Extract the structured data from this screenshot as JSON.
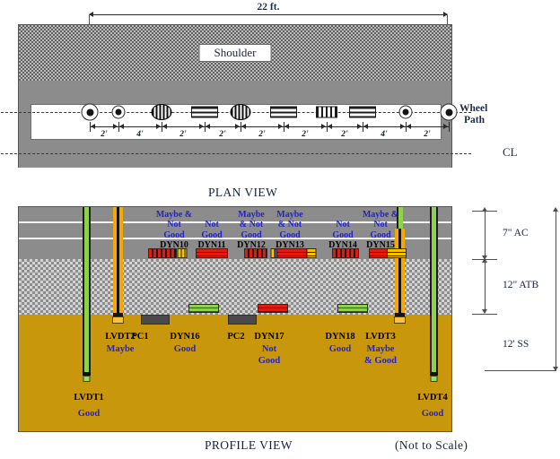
{
  "figure": {
    "plan_view_title": "PLAN VIEW",
    "profile_view_title": "PROFILE VIEW",
    "not_to_scale": "(Not to Scale)"
  },
  "plan": {
    "overall_dimension": "22 ft.",
    "shoulder_label": "Shoulder",
    "wheel_path_line1": "Wheel",
    "wheel_path_line2": "Path",
    "centerline_label": "CL",
    "spacings": [
      "2'",
      "4'",
      "2'",
      "2'",
      "2'",
      "2'",
      "2'",
      "4'",
      "2'"
    ],
    "sensors": [
      {
        "name": "lvdt-circle-large-left",
        "type": "circle-large"
      },
      {
        "name": "lvdt-circle-small-left",
        "type": "circle-small"
      },
      {
        "name": "gauge-oval-vertical-1",
        "type": "oval-vertical"
      },
      {
        "name": "gauge-bars-horizontal-1",
        "type": "bars-horizontal"
      },
      {
        "name": "gauge-oval-vertical-2",
        "type": "oval-vertical"
      },
      {
        "name": "gauge-bars-horizontal-2",
        "type": "bars-horizontal"
      },
      {
        "name": "gauge-bars-vertical-1",
        "type": "bars-vertical"
      },
      {
        "name": "gauge-bars-horizontal-3",
        "type": "bars-horizontal"
      },
      {
        "name": "lvdt-circle-small-right",
        "type": "circle-small"
      },
      {
        "name": "lvdt-circle-large-right",
        "type": "circle-large"
      }
    ]
  },
  "profile": {
    "layers": [
      {
        "id": "ac",
        "thickness_label": "7\" AC"
      },
      {
        "id": "atb",
        "thickness_label": "12\" ATB"
      },
      {
        "id": "ss",
        "thickness_label": "12' SS"
      }
    ],
    "ac_gauges": [
      {
        "id": "DYN10",
        "label": "DYN10",
        "status": "Maybe &\nNot\nGood",
        "status_lines": [
          "Maybe &",
          "Not",
          "Good"
        ]
      },
      {
        "id": "DYN11",
        "label": "DYN11",
        "status_lines": [
          "Not",
          "Good"
        ]
      },
      {
        "id": "DYN12",
        "label": "DYN12",
        "status_lines": [
          "Maybe",
          "& Not",
          "Good"
        ]
      },
      {
        "id": "DYN13",
        "label": "DYN13",
        "status_lines": [
          "Maybe",
          "& Not",
          "Good"
        ]
      },
      {
        "id": "DYN14",
        "label": "DYN14",
        "status_lines": [
          "Not",
          "Good"
        ]
      },
      {
        "id": "DYN15",
        "label": "DYN15",
        "status_lines": [
          "Maybe &",
          "Not",
          "Good"
        ]
      }
    ],
    "lower_instruments": [
      {
        "id": "LVDT2",
        "label": "LVDT2",
        "status_lines": [
          "Maybe"
        ]
      },
      {
        "id": "PC1",
        "label": "PC1",
        "status_lines": []
      },
      {
        "id": "DYN16",
        "label": "DYN16",
        "status_lines": [
          "Good"
        ]
      },
      {
        "id": "PC2",
        "label": "PC2",
        "status_lines": []
      },
      {
        "id": "DYN17",
        "label": "DYN17",
        "status_lines": [
          "Not",
          "Good"
        ]
      },
      {
        "id": "DYN18",
        "label": "DYN18",
        "status_lines": [
          "Good"
        ]
      },
      {
        "id": "LVDT3",
        "label": "LVDT3",
        "status_lines": [
          "Maybe",
          "& Good"
        ]
      }
    ],
    "deep_instruments": [
      {
        "id": "LVDT1",
        "label": "LVDT1",
        "status_lines": [
          "Good"
        ]
      },
      {
        "id": "LVDT4",
        "label": "LVDT4",
        "status_lines": [
          "Good"
        ]
      }
    ]
  },
  "colors": {
    "status_text": "#2222cc",
    "label_text": "#000000",
    "subgrade": "#c9970b",
    "asphalt": "#8c8c8c",
    "gauge_red": "#e01b10",
    "gauge_green": "#8fd14a",
    "gauge_yellow": "#f5c400",
    "rod_orange": "#f5a800"
  }
}
